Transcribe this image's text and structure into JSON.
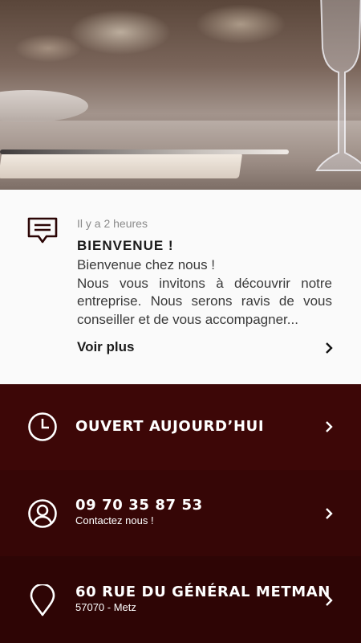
{
  "hero": {
    "image": "restaurant-table-photo"
  },
  "notice": {
    "icon": "message-icon",
    "time": "Il y a 2 heures",
    "title": "BIENVENUE !",
    "body": "Bienvenue chez nous !\nNous vous invitons à découvrir notre entreprise. Nous serons ravis de vous conseiller et de vous accompagner...",
    "more_label": "Voir plus"
  },
  "rows": [
    {
      "icon": "clock-icon",
      "title": "OUVERT AUJOURD’HUI",
      "subtitle": ""
    },
    {
      "icon": "user-icon",
      "title": "09 70 35 87 53",
      "subtitle": "Contactez nous !"
    },
    {
      "icon": "location-pin-icon",
      "title": "60 RUE DU GÉNÉRAL METMAN",
      "subtitle": "57070  - Metz"
    }
  ],
  "colors": {
    "row_bg": "#3d0707",
    "text_dark": "#1a1a1a",
    "icon_dark": "#2b0505"
  }
}
